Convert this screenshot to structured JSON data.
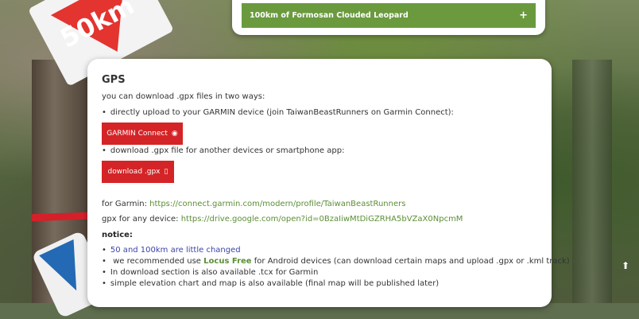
{
  "accordion": {
    "title": "100km of Formosan Clouded Leopard",
    "toggle": "+"
  },
  "sign_text": "50km",
  "gps": {
    "heading": "GPS",
    "intro": "you can download .gpx files in two ways:",
    "option1": "directly upload to your GARMIN device (join TaiwanBeastRunners on Garmin Connect):",
    "garmin_button": "GARMIN Connect",
    "garmin_icon": "◉",
    "option2": "download .gpx file for another devices or smartphone app:",
    "download_button": "download .gpx",
    "download_icon": "▯",
    "garmin_label": "for Garmin:",
    "garmin_url": "https://connect.garmin.com/modern/profile/TaiwanBeastRunners",
    "gpx_label": "gpx for any device:",
    "gpx_url": "https://drive.google.com/open?id=0BzaIiwMtDiGZRHA5bVZaX0NpcmM",
    "notice_heading": "notice:",
    "notice1": "50 and 100km are little changed",
    "notice2_pre": "we recommended use",
    "notice2_link": "Locus Free",
    "notice2_post": "for Android devices (can download certain maps and upload .gpx or .kml track)",
    "notice3": "In download section is also available .tcx for Garmin",
    "notice4": "simple elevation chart and map is also available (final map will be published later)"
  },
  "scroll_top_icon": "⬆"
}
